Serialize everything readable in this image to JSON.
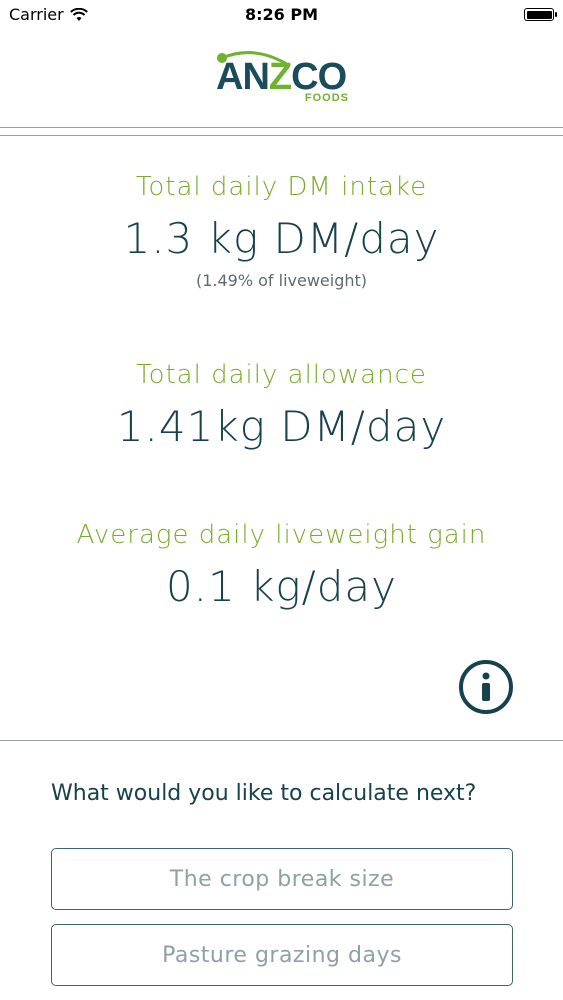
{
  "status_bar": {
    "carrier": "Carrier",
    "time": "8:26 PM"
  },
  "logo": {
    "wordmark_a": "A",
    "wordmark_n": "N",
    "wordmark_z": "Z",
    "wordmark_co": "CO",
    "sub": "FOODS"
  },
  "results": {
    "intake": {
      "label": "Total daily DM intake",
      "value": "1.3 kg DM/day",
      "note": "(1.49% of liveweight)"
    },
    "allowance": {
      "label": "Total daily allowance",
      "value": "1.41kg DM/day"
    },
    "gain": {
      "label": "Average daily liveweight gain",
      "value": "0.1 kg/day"
    }
  },
  "next": {
    "prompt": "What would you like to calculate next?",
    "options": [
      "The crop break size",
      "Pasture grazing days"
    ]
  },
  "colors": {
    "accent_green": "#79ac2a",
    "dark_teal": "#16414d"
  }
}
